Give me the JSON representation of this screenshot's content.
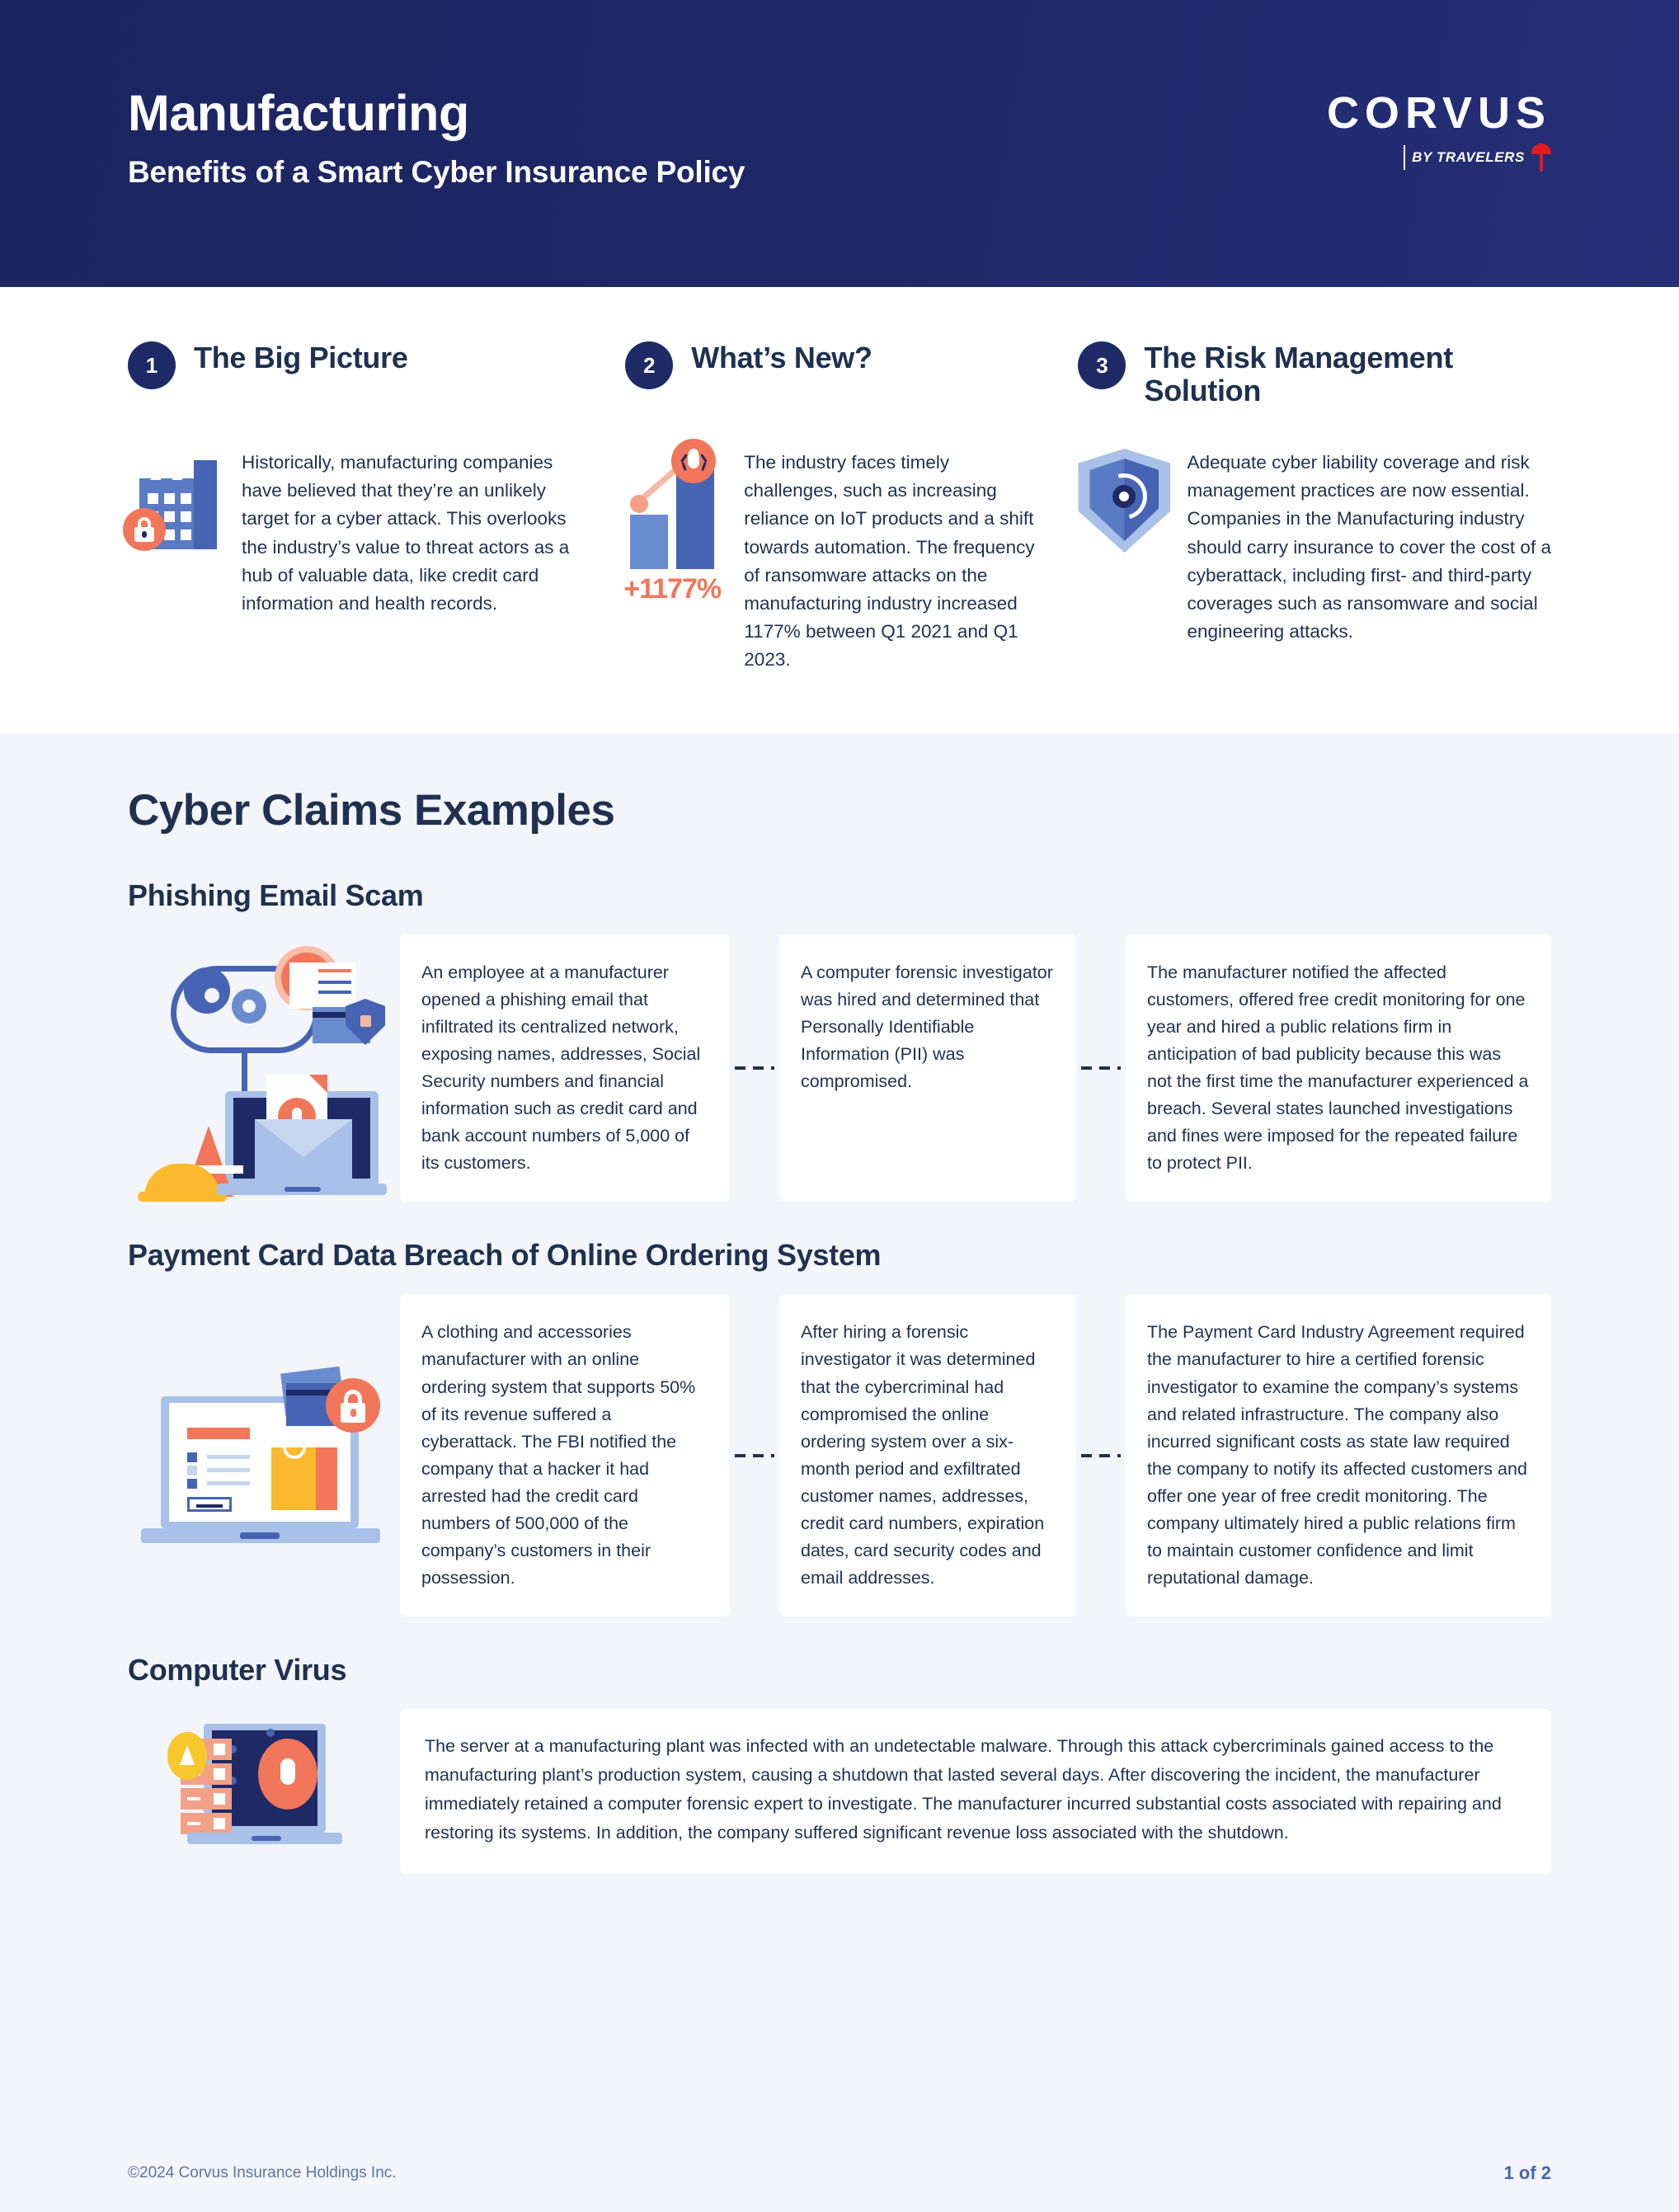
{
  "header": {
    "title": "Manufacturing",
    "subtitle": "Benefits of a Smart Cyber Insurance Policy",
    "logo_word": "CORVUS",
    "logo_byline": "BY TRAVELERS"
  },
  "colors": {
    "header_navy": "#1e2a66",
    "text_navy": "#1f3050",
    "accent_coral": "#f2765a",
    "accent_blue": "#4763b4",
    "panel_bg": "#f3f5fb",
    "logo_red": "#e01b22"
  },
  "top_sections": [
    {
      "number": "1",
      "title": "The Big Picture",
      "body": "Historically, manufacturing companies have believed that they’re an unlikely target for a cyber attack. This overlooks the industry’s value to threat actors as a hub of valuable data, like credit card information and health records.",
      "icon": "factory-lock-icon"
    },
    {
      "number": "2",
      "title": "What’s New?",
      "body": "The industry faces timely challenges, such as increasing reliance on IoT products and a shift towards automation. The frequency of ransomware attacks on the manufacturing industry increased 1177% between Q1 2021 and Q1 2023.",
      "icon": "bar-chart-bug-icon",
      "stat": "+1177%"
    },
    {
      "number": "3",
      "title": "The Risk Management Solution",
      "body": "Adequate cyber liability coverage and risk management practices are now essential. Companies in the Manufacturing industry should carry insurance to cover the cost of a cyberattack, including first- and third-party coverages such as ransomware and social engineering attacks.",
      "icon": "shield-gear-icon"
    }
  ],
  "claims": {
    "title": "Cyber Claims Examples",
    "examples": [
      {
        "heading": "Phishing Email Scam",
        "icon": "phishing-email-illustration",
        "steps": [
          "An employee at a manufacturer opened a phishing email that infiltrated its centralized network, exposing names, addresses, Social Security numbers and financial information such as credit card and bank account numbers of 5,000 of its customers.",
          "A computer forensic investigator was hired and determined that Personally Identifiable Information (PII) was compromised.",
          "The manufacturer notified the affected customers, offered free credit monitoring for one year and hired a public relations firm in anticipation of bad publicity because this was not the first time the manufacturer experienced a breach. Several states launched investigations and fines were imposed for the repeated failure to protect PII."
        ]
      },
      {
        "heading": "Payment Card Data Breach of Online Ordering System",
        "icon": "online-ordering-card-illustration",
        "steps": [
          "A clothing and accessories manufacturer with an online ordering system that supports 50% of its revenue suffered a cyberattack. The FBI notified the company that a hacker it had arrested had the credit card numbers of 500,000 of the company’s customers in their possession.",
          "After hiring a forensic investigator it was determined that the cybercriminal had compromised the online ordering system over a six-month period and exfiltrated customer names, addresses, credit card numbers, expiration dates, card security codes and email addresses.",
          "The Payment Card Industry Agreement required the manufacturer to hire a certified forensic investigator to examine the company’s systems and related infrastructure. The company also incurred significant costs as state law required the company to notify its affected customers and offer one year of free credit monitoring. The company ultimately hired a public relations firm to maintain customer confidence and limit reputational damage."
        ]
      }
    ],
    "virus": {
      "heading": "Computer Virus",
      "icon": "server-virus-illustration",
      "body": "The server at a manufacturing plant was infected with an undetectable malware. Through this attack cybercriminals gained access to the manufacturing plant’s production system, causing a shutdown that lasted several days. After discovering the incident, the manufacturer immediately retained a computer forensic expert to investigate. The manufacturer incurred substantial costs associated with repairing and restoring its systems. In addition, the company suffered significant revenue loss associated with the shutdown."
    }
  },
  "footer": {
    "copyright": "©2024 Corvus Insurance Holdings Inc.",
    "page": "1 of 2"
  }
}
